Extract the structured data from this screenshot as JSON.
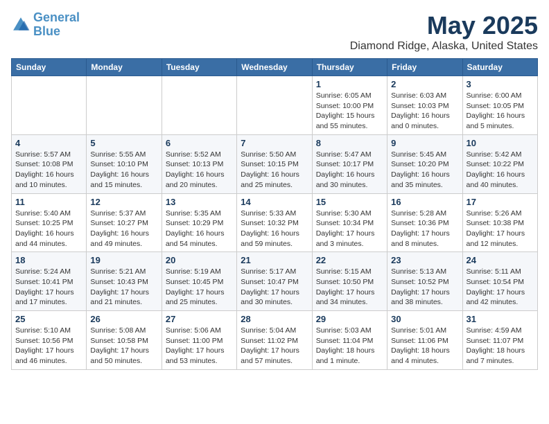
{
  "logo": {
    "line1": "General",
    "line2": "Blue"
  },
  "title": "May 2025",
  "subtitle": "Diamond Ridge, Alaska, United States",
  "days_of_week": [
    "Sunday",
    "Monday",
    "Tuesday",
    "Wednesday",
    "Thursday",
    "Friday",
    "Saturday"
  ],
  "weeks": [
    [
      {
        "day": "",
        "info": ""
      },
      {
        "day": "",
        "info": ""
      },
      {
        "day": "",
        "info": ""
      },
      {
        "day": "",
        "info": ""
      },
      {
        "day": "1",
        "info": "Sunrise: 6:05 AM\nSunset: 10:00 PM\nDaylight: 15 hours and 55 minutes."
      },
      {
        "day": "2",
        "info": "Sunrise: 6:03 AM\nSunset: 10:03 PM\nDaylight: 16 hours and 0 minutes."
      },
      {
        "day": "3",
        "info": "Sunrise: 6:00 AM\nSunset: 10:05 PM\nDaylight: 16 hours and 5 minutes."
      }
    ],
    [
      {
        "day": "4",
        "info": "Sunrise: 5:57 AM\nSunset: 10:08 PM\nDaylight: 16 hours and 10 minutes."
      },
      {
        "day": "5",
        "info": "Sunrise: 5:55 AM\nSunset: 10:10 PM\nDaylight: 16 hours and 15 minutes."
      },
      {
        "day": "6",
        "info": "Sunrise: 5:52 AM\nSunset: 10:13 PM\nDaylight: 16 hours and 20 minutes."
      },
      {
        "day": "7",
        "info": "Sunrise: 5:50 AM\nSunset: 10:15 PM\nDaylight: 16 hours and 25 minutes."
      },
      {
        "day": "8",
        "info": "Sunrise: 5:47 AM\nSunset: 10:17 PM\nDaylight: 16 hours and 30 minutes."
      },
      {
        "day": "9",
        "info": "Sunrise: 5:45 AM\nSunset: 10:20 PM\nDaylight: 16 hours and 35 minutes."
      },
      {
        "day": "10",
        "info": "Sunrise: 5:42 AM\nSunset: 10:22 PM\nDaylight: 16 hours and 40 minutes."
      }
    ],
    [
      {
        "day": "11",
        "info": "Sunrise: 5:40 AM\nSunset: 10:25 PM\nDaylight: 16 hours and 44 minutes."
      },
      {
        "day": "12",
        "info": "Sunrise: 5:37 AM\nSunset: 10:27 PM\nDaylight: 16 hours and 49 minutes."
      },
      {
        "day": "13",
        "info": "Sunrise: 5:35 AM\nSunset: 10:29 PM\nDaylight: 16 hours and 54 minutes."
      },
      {
        "day": "14",
        "info": "Sunrise: 5:33 AM\nSunset: 10:32 PM\nDaylight: 16 hours and 59 minutes."
      },
      {
        "day": "15",
        "info": "Sunrise: 5:30 AM\nSunset: 10:34 PM\nDaylight: 17 hours and 3 minutes."
      },
      {
        "day": "16",
        "info": "Sunrise: 5:28 AM\nSunset: 10:36 PM\nDaylight: 17 hours and 8 minutes."
      },
      {
        "day": "17",
        "info": "Sunrise: 5:26 AM\nSunset: 10:38 PM\nDaylight: 17 hours and 12 minutes."
      }
    ],
    [
      {
        "day": "18",
        "info": "Sunrise: 5:24 AM\nSunset: 10:41 PM\nDaylight: 17 hours and 17 minutes."
      },
      {
        "day": "19",
        "info": "Sunrise: 5:21 AM\nSunset: 10:43 PM\nDaylight: 17 hours and 21 minutes."
      },
      {
        "day": "20",
        "info": "Sunrise: 5:19 AM\nSunset: 10:45 PM\nDaylight: 17 hours and 25 minutes."
      },
      {
        "day": "21",
        "info": "Sunrise: 5:17 AM\nSunset: 10:47 PM\nDaylight: 17 hours and 30 minutes."
      },
      {
        "day": "22",
        "info": "Sunrise: 5:15 AM\nSunset: 10:50 PM\nDaylight: 17 hours and 34 minutes."
      },
      {
        "day": "23",
        "info": "Sunrise: 5:13 AM\nSunset: 10:52 PM\nDaylight: 17 hours and 38 minutes."
      },
      {
        "day": "24",
        "info": "Sunrise: 5:11 AM\nSunset: 10:54 PM\nDaylight: 17 hours and 42 minutes."
      }
    ],
    [
      {
        "day": "25",
        "info": "Sunrise: 5:10 AM\nSunset: 10:56 PM\nDaylight: 17 hours and 46 minutes."
      },
      {
        "day": "26",
        "info": "Sunrise: 5:08 AM\nSunset: 10:58 PM\nDaylight: 17 hours and 50 minutes."
      },
      {
        "day": "27",
        "info": "Sunrise: 5:06 AM\nSunset: 11:00 PM\nDaylight: 17 hours and 53 minutes."
      },
      {
        "day": "28",
        "info": "Sunrise: 5:04 AM\nSunset: 11:02 PM\nDaylight: 17 hours and 57 minutes."
      },
      {
        "day": "29",
        "info": "Sunrise: 5:03 AM\nSunset: 11:04 PM\nDaylight: 18 hours and 1 minute."
      },
      {
        "day": "30",
        "info": "Sunrise: 5:01 AM\nSunset: 11:06 PM\nDaylight: 18 hours and 4 minutes."
      },
      {
        "day": "31",
        "info": "Sunrise: 4:59 AM\nSunset: 11:07 PM\nDaylight: 18 hours and 7 minutes."
      }
    ]
  ]
}
